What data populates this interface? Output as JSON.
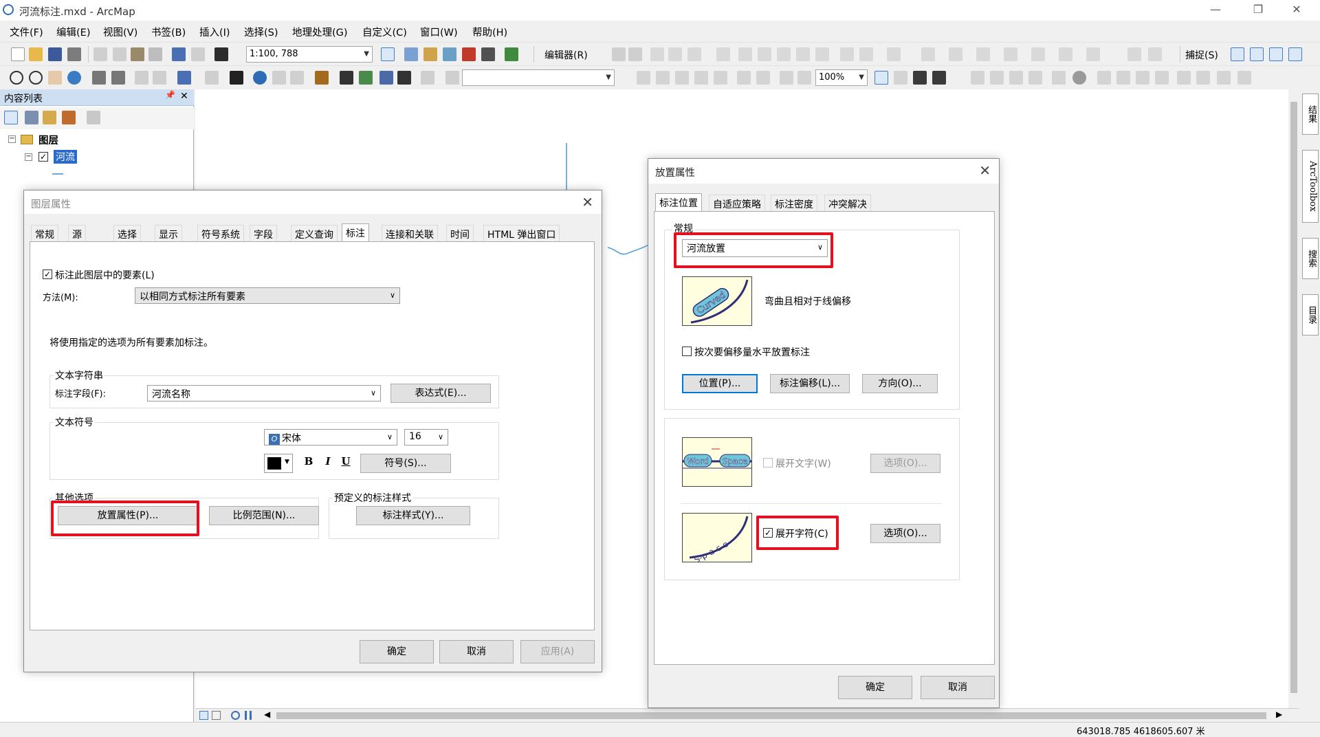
{
  "window": {
    "title": "河流标注.mxd - ArcMap",
    "min": "—",
    "max": "❐",
    "close": "✕"
  },
  "menu": [
    "文件(F)",
    "编辑(E)",
    "视图(V)",
    "书签(B)",
    "插入(I)",
    "选择(S)",
    "地理处理(G)",
    "自定义(C)",
    "窗口(W)",
    "帮助(H)"
  ],
  "toolbar1": {
    "scale": "1:100, 788",
    "editor": "编辑器(R)",
    "snapping": "捕捉(S)"
  },
  "toolbar2": {
    "zoom": "100%"
  },
  "toc": {
    "title": "内容列表",
    "pin": "📌",
    "close": "✕",
    "root": "图层",
    "layer": "河流"
  },
  "dock_tabs": [
    "结果",
    "ArcToolbox",
    "搜索",
    "目录"
  ],
  "status": {
    "coords": "643018.785  4618605.607 米"
  },
  "layer_props": {
    "title": "图层属性",
    "tabs": [
      "常规",
      "源",
      "选择",
      "显示",
      "符号系统",
      "字段",
      "定义查询",
      "标注",
      "连接和关联",
      "时间",
      "HTML 弹出窗口"
    ],
    "active_tab": "标注",
    "label_check": "标注此图层中的要素(L)",
    "method_label": "方法(M):",
    "method_value": "以相同方式标注所有要素",
    "desc": "将使用指定的选项为所有要素加标注。",
    "text_string_group": "文本字符串",
    "label_field_label": "标注字段(F):",
    "label_field_value": "河流名称",
    "expression_btn": "表达式(E)...",
    "text_symbol_group": "文本符号",
    "font_value": "宋体",
    "font_icon": "O",
    "size_value": "16",
    "bold": "B",
    "italic": "I",
    "underline": "U",
    "symbol_btn": "符号(S)...",
    "other_group": "其他选项",
    "placement_btn": "放置属性(P)...",
    "scale_btn": "比例范围(N)...",
    "predef_group": "预定义的标注样式",
    "style_btn": "标注样式(Y)...",
    "ok": "确定",
    "cancel": "取消",
    "apply": "应用(A)"
  },
  "placement": {
    "title": "放置属性",
    "tabs": [
      "标注位置",
      "自适应策略",
      "标注密度",
      "冲突解决"
    ],
    "active_tab": "标注位置",
    "general_group": "常规",
    "mode_value": "河流放置",
    "curved_text": "Curved",
    "mode_desc": "弯曲且相对于线偏移",
    "horizontal_check": "按次要偏移量水平放置标注",
    "pos_btn": "位置(P)...",
    "offset_btn": "标注偏移(L)...",
    "orient_btn": "方向(O)...",
    "word1": "Word",
    "word2": "Space",
    "spread_words": "展开文字(W)",
    "options_w": "选项(O)...",
    "spacing_text": "S-p-a-c-e",
    "spread_chars": "展开字符(C)",
    "options_c": "选项(O)...",
    "ok": "确定",
    "cancel": "取消"
  }
}
